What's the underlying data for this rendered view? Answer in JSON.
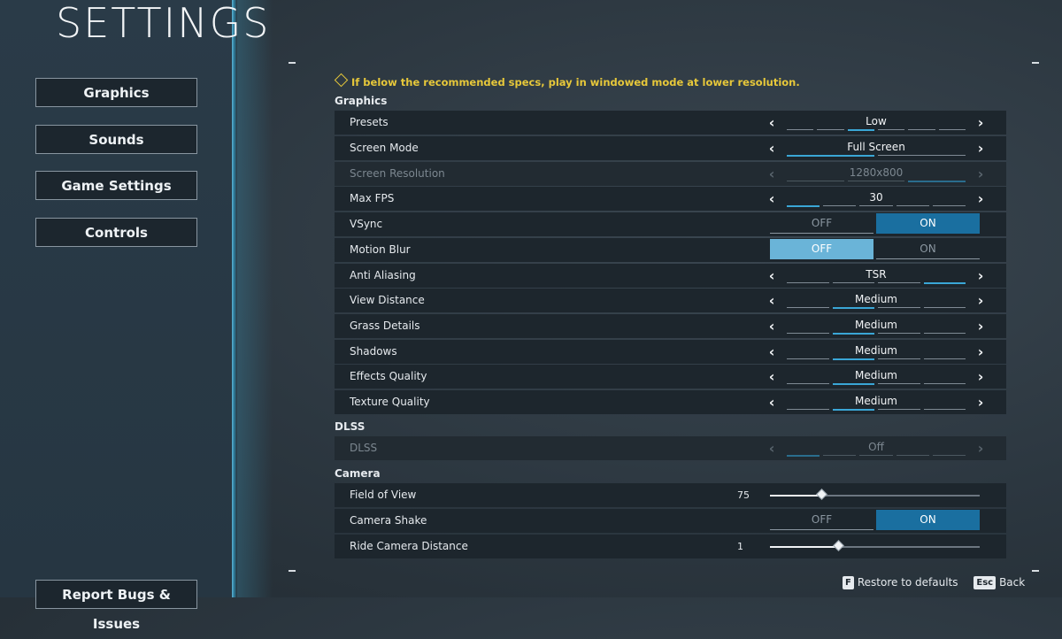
{
  "page_title": "SETTINGS",
  "nav": {
    "graphics": "Graphics",
    "sounds": "Sounds",
    "game_settings": "Game Settings",
    "controls": "Controls",
    "report_bugs": "Report Bugs & Issues"
  },
  "warning": "If below the recommended specs, play in windowed mode at lower resolution.",
  "sections": {
    "graphics": "Graphics",
    "dlss": "DLSS",
    "camera": "Camera"
  },
  "rows": {
    "presets": {
      "label": "Presets",
      "value": "Low",
      "segments": 6,
      "selected_segment": 3
    },
    "screen_mode": {
      "label": "Screen Mode",
      "value": "Full Screen",
      "segments": 2,
      "selected_segment": 1
    },
    "screen_resolution": {
      "label": "Screen Resolution",
      "value": "1280x800",
      "segments": 3,
      "selected_segment": 3
    },
    "max_fps": {
      "label": "Max FPS",
      "value": "30",
      "segments": 5,
      "selected_segment": 1
    },
    "vsync": {
      "label": "VSync",
      "off": "OFF",
      "on": "ON",
      "selected": "ON"
    },
    "motion_blur": {
      "label": "Motion Blur",
      "off": "OFF",
      "on": "ON",
      "selected": "OFF"
    },
    "anti_aliasing": {
      "label": "Anti Aliasing",
      "value": "TSR",
      "segments": 4,
      "selected_segment": 4
    },
    "view_distance": {
      "label": "View Distance",
      "value": "Medium",
      "segments": 4,
      "selected_segment": 2
    },
    "grass_details": {
      "label": "Grass Details",
      "value": "Medium",
      "segments": 4,
      "selected_segment": 2
    },
    "shadows": {
      "label": "Shadows",
      "value": "Medium",
      "segments": 4,
      "selected_segment": 2
    },
    "effects_quality": {
      "label": "Effects Quality",
      "value": "Medium",
      "segments": 4,
      "selected_segment": 2
    },
    "texture_quality": {
      "label": "Texture Quality",
      "value": "Medium",
      "segments": 4,
      "selected_segment": 2
    },
    "dlss": {
      "label": "DLSS",
      "value": "Off",
      "segments": 5,
      "selected_segment": 1
    },
    "field_of_view": {
      "label": "Field of View",
      "value": "75",
      "fraction": 0.25
    },
    "camera_shake": {
      "label": "Camera Shake",
      "off": "OFF",
      "on": "ON",
      "selected": "ON"
    },
    "ride_camera_distance": {
      "label": "Ride Camera Distance",
      "value": "1",
      "fraction": 0.33
    }
  },
  "footer": {
    "restore_key": "F",
    "restore_label": "Restore to defaults",
    "back_key": "Esc",
    "back_label": "Back"
  },
  "colors": {
    "accent": "#3aa6d6",
    "toggle_on": "#1a6fa0",
    "toggle_off_selected": "#6ab4d8",
    "warning": "#e7c83a"
  }
}
